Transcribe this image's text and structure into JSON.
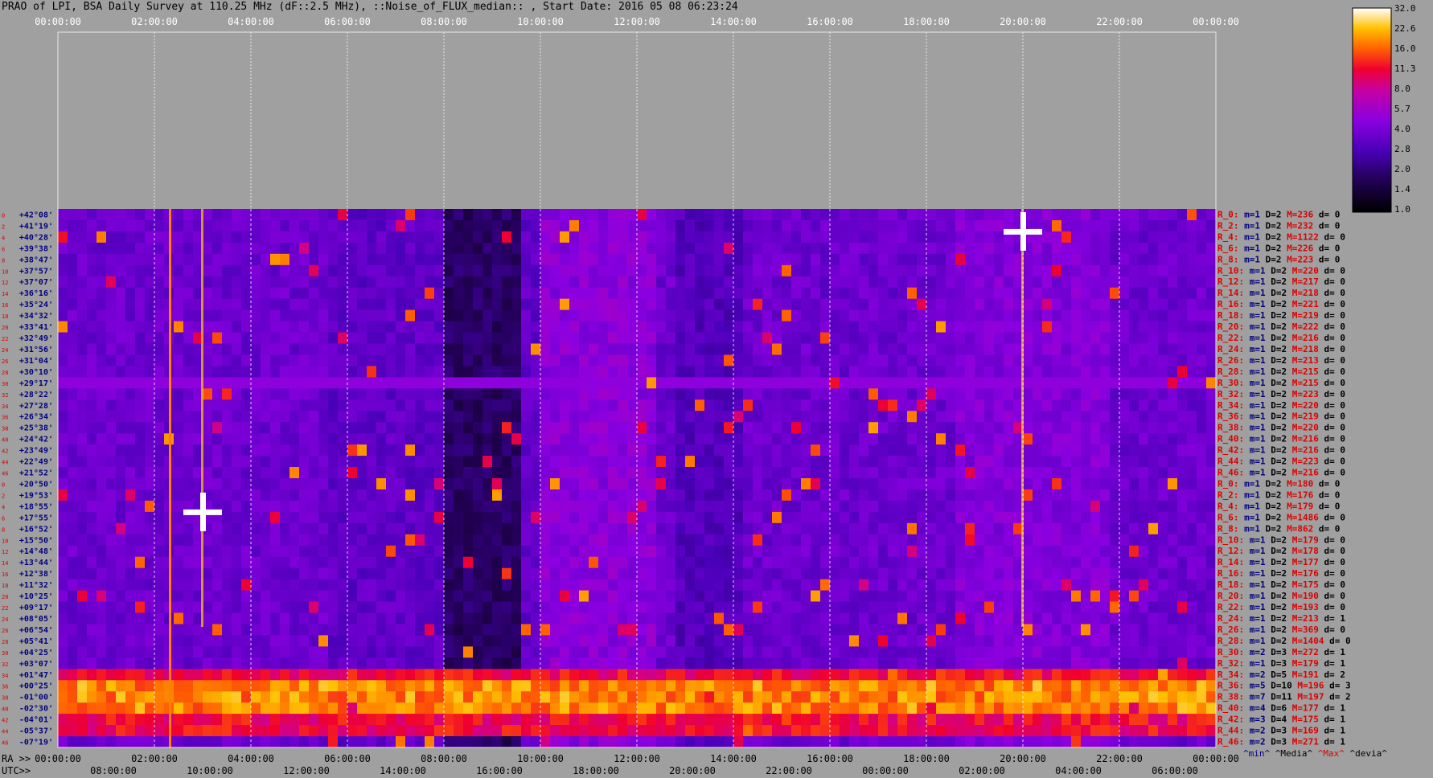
{
  "header": {
    "title": "PRAO of LPI, BSA Daily Survey at 110.25 MHz (dF::2.5 MHz), ::Noise_of_FLUX_median:: , Start Date: 2016 05 08 06:23:24"
  },
  "axes": {
    "top_ticks": [
      "00:00:00",
      "02:00:00",
      "04:00:00",
      "06:00:00",
      "08:00:00",
      "10:00:00",
      "12:00:00",
      "14:00:00",
      "16:00:00",
      "18:00:00",
      "20:00:00",
      "22:00:00",
      "00:00:00"
    ],
    "ra_label": "RA >>",
    "ra_ticks": [
      "00:00:00",
      "02:00:00",
      "04:00:00",
      "06:00:00",
      "08:00:00",
      "10:00:00",
      "12:00:00",
      "14:00:00",
      "16:00:00",
      "18:00:00",
      "20:00:00",
      "22:00:00",
      "00:00:00"
    ],
    "utc_label": "UTC>>",
    "utc_ticks": [
      "08:00:00",
      "10:00:00",
      "12:00:00",
      "14:00:00",
      "16:00:00",
      "18:00:00",
      "20:00:00",
      "22:00:00",
      "00:00:00",
      "02:00:00",
      "04:00:00",
      "06:00:00"
    ],
    "dec_labels": [
      "+42°08'",
      "+41°19'",
      "+40°28'",
      "+39°38'",
      "+38°47'",
      "+37°57'",
      "+37°07'",
      "+36°16'",
      "+35°24'",
      "+34°32'",
      "+33°41'",
      "+32°49'",
      "+31°56'",
      "+31°04'",
      "+30°10'",
      "+29°17'",
      "+28°22'",
      "+27°28'",
      "+26°34'",
      "+25°38'",
      "+24°42'",
      "+23°49'",
      "+22°49'",
      "+21°52'",
      "+20°50'",
      "+19°53'",
      "+18°55'",
      "+17°55'",
      "+16°52'",
      "+15°50'",
      "+14°48'",
      "+13°44'",
      "+12°38'",
      "+11°32'",
      "+10°25'",
      "+09°17'",
      "+08°05'",
      "+06°54'",
      "+05°41'",
      "+04°25'",
      "+03°07'",
      "+01°47'",
      "+00°25'",
      "-01°00'",
      "-02°30'",
      "-04°01'",
      "-05°37'",
      "-07°19'"
    ]
  },
  "colorbar": {
    "ticks": [
      "32.0",
      "22.6",
      "16.0",
      "11.3",
      "8.0",
      "5.7",
      "4.0",
      "2.8",
      "2.0",
      "1.4",
      "1.0"
    ]
  },
  "stats": {
    "rows": [
      [
        "R_0:",
        "m=1",
        "D=2",
        "M=236",
        "d= 0"
      ],
      [
        "R_2:",
        "m=1",
        "D=2",
        "M=232",
        "d= 0"
      ],
      [
        "R_4:",
        "m=1",
        "D=2",
        "M=1122",
        "d= 0"
      ],
      [
        "R_6:",
        "m=1",
        "D=2",
        "M=226",
        "d= 0"
      ],
      [
        "R_8:",
        "m=1",
        "D=2",
        "M=223",
        "d= 0"
      ],
      [
        "R_10:",
        "m=1",
        "D=2",
        "M=220",
        "d= 0"
      ],
      [
        "R_12:",
        "m=1",
        "D=2",
        "M=217",
        "d= 0"
      ],
      [
        "R_14:",
        "m=1",
        "D=2",
        "M=218",
        "d= 0"
      ],
      [
        "R_16:",
        "m=1",
        "D=2",
        "M=221",
        "d= 0"
      ],
      [
        "R_18:",
        "m=1",
        "D=2",
        "M=219",
        "d= 0"
      ],
      [
        "R_20:",
        "m=1",
        "D=2",
        "M=222",
        "d= 0"
      ],
      [
        "R_22:",
        "m=1",
        "D=2",
        "M=216",
        "d= 0"
      ],
      [
        "R_24:",
        "m=1",
        "D=2",
        "M=218",
        "d= 0"
      ],
      [
        "R_26:",
        "m=1",
        "D=2",
        "M=213",
        "d= 0"
      ],
      [
        "R_28:",
        "m=1",
        "D=2",
        "M=215",
        "d= 0"
      ],
      [
        "R_30:",
        "m=1",
        "D=2",
        "M=215",
        "d= 0"
      ],
      [
        "R_32:",
        "m=1",
        "D=2",
        "M=223",
        "d= 0"
      ],
      [
        "R_34:",
        "m=1",
        "D=2",
        "M=220",
        "d= 0"
      ],
      [
        "R_36:",
        "m=1",
        "D=2",
        "M=219",
        "d= 0"
      ],
      [
        "R_38:",
        "m=1",
        "D=2",
        "M=220",
        "d= 0"
      ],
      [
        "R_40:",
        "m=1",
        "D=2",
        "M=216",
        "d= 0"
      ],
      [
        "R_42:",
        "m=1",
        "D=2",
        "M=216",
        "d= 0"
      ],
      [
        "R_44:",
        "m=1",
        "D=2",
        "M=223",
        "d= 0"
      ],
      [
        "R_46:",
        "m=1",
        "D=2",
        "M=216",
        "d= 0"
      ],
      [
        "R_0:",
        "m=1",
        "D=2",
        "M=180",
        "d= 0"
      ],
      [
        "R_2:",
        "m=1",
        "D=2",
        "M=176",
        "d= 0"
      ],
      [
        "R_4:",
        "m=1",
        "D=2",
        "M=179",
        "d= 0"
      ],
      [
        "R_6:",
        "m=1",
        "D=2",
        "M=1486",
        "d= 0"
      ],
      [
        "R_8:",
        "m=1",
        "D=2",
        "M=862",
        "d= 0"
      ],
      [
        "R_10:",
        "m=1",
        "D=2",
        "M=179",
        "d= 0"
      ],
      [
        "R_12:",
        "m=1",
        "D=2",
        "M=178",
        "d= 0"
      ],
      [
        "R_14:",
        "m=1",
        "D=2",
        "M=177",
        "d= 0"
      ],
      [
        "R_16:",
        "m=1",
        "D=2",
        "M=176",
        "d= 0"
      ],
      [
        "R_18:",
        "m=1",
        "D=2",
        "M=175",
        "d= 0"
      ],
      [
        "R_20:",
        "m=1",
        "D=2",
        "M=190",
        "d= 0"
      ],
      [
        "R_22:",
        "m=1",
        "D=2",
        "M=193",
        "d= 0"
      ],
      [
        "R_24:",
        "m=1",
        "D=2",
        "M=213",
        "d= 1"
      ],
      [
        "R_26:",
        "m=1",
        "D=2",
        "M=369",
        "d= 0"
      ],
      [
        "R_28:",
        "m=1",
        "D=2",
        "M=1404",
        "d= 0"
      ],
      [
        "R_30:",
        "m=2",
        "D=3",
        "M=272",
        "d= 1"
      ],
      [
        "R_32:",
        "m=1",
        "D=3",
        "M=179",
        "d= 1"
      ],
      [
        "R_34:",
        "m=2",
        "D=5",
        "M=191",
        "d= 2"
      ],
      [
        "R_36:",
        "m=5",
        "D=10",
        "M=196",
        "d= 3"
      ],
      [
        "R_38:",
        "m=7",
        "D=11",
        "M=197",
        "d= 2"
      ],
      [
        "R_40:",
        "m=4",
        "D=6",
        "M=177",
        "d= 1"
      ],
      [
        "R_42:",
        "m=3",
        "D=4",
        "M=175",
        "d= 1"
      ],
      [
        "R_44:",
        "m=2",
        "D=3",
        "M=169",
        "d= 1"
      ],
      [
        "R_46:",
        "m=2",
        "D=3",
        "M=271",
        "d= 1"
      ]
    ],
    "legend": [
      "^min^",
      "^Media^",
      "^Max^",
      "^devia^"
    ]
  },
  "colors": {
    "background": "#a0a0a0",
    "stat_label": "#dd0000",
    "stat_min": "#000080",
    "stat_dev": "#000000",
    "legend_min": "#000080",
    "legend_media": "#000000",
    "legend_max": "#dd0000",
    "legend_dev": "#000000",
    "dec_text": "#000080",
    "row_index": "#dd0000"
  },
  "chart_data": {
    "type": "heatmap",
    "title": "PRAO of LPI, BSA Daily Survey at 110.25 MHz (dF::2.5 MHz), ::Noise_of_FLUX_median:: , Start Date: 2016 05 08 06:23:24",
    "x_axis": "RA (hours), 0 to 24",
    "x_range": [
      0,
      24
    ],
    "y_rows": 48,
    "colormap": "gnuplot-like (black-purple-red-yellow-white)",
    "color_range": [
      1.0,
      32.0
    ],
    "color_scale": "log",
    "features": {
      "bright_band_dec": [
        "+00°25'",
        "-01°00'"
      ],
      "horizontal_line_dec": "+30°10'",
      "point_sources_ra": [
        3.0,
        20.0
      ],
      "vertical_stripe_ra": 2.3
    }
  }
}
